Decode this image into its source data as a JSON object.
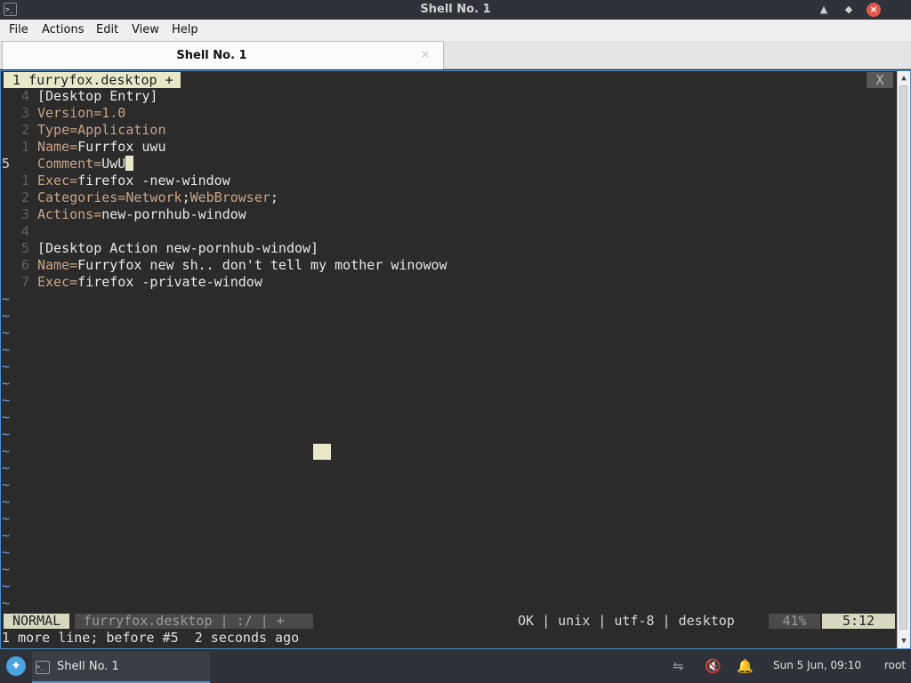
{
  "window": {
    "title": "Shell No. 1",
    "controls": [
      "shade-icon",
      "maximize-icon",
      "close-icon"
    ]
  },
  "menu": [
    {
      "label": "File",
      "x": 0
    },
    {
      "label": "Actions"
    },
    {
      "label": "Edit"
    },
    {
      "label": "View"
    },
    {
      "label": "Help"
    }
  ],
  "tab": {
    "label": "Shell No. 1",
    "close": "×"
  },
  "vim": {
    "buffer_tab": "1 furryfox.desktop +",
    "buffer_close": "X",
    "lines": [
      {
        "num": "4",
        "parts": [
          {
            "t": "[Desktop Entry]",
            "c": "n"
          }
        ]
      },
      {
        "num": "3",
        "parts": [
          {
            "t": "Version=1.0",
            "c": "k"
          }
        ]
      },
      {
        "num": "2",
        "parts": [
          {
            "t": "Type=Application",
            "c": "k"
          }
        ]
      },
      {
        "num": "1",
        "parts": [
          {
            "t": "Name=",
            "c": "k"
          },
          {
            "t": "Furrfox uwu",
            "c": "n"
          }
        ]
      },
      {
        "num": "5",
        "cur": true,
        "parts": [
          {
            "t": "Comment=",
            "c": "k"
          },
          {
            "t": "UwU",
            "c": "n"
          }
        ],
        "cursor": true
      },
      {
        "num": "1",
        "parts": [
          {
            "t": "Exec=",
            "c": "k"
          },
          {
            "t": "firefox -new-window",
            "c": "n"
          }
        ]
      },
      {
        "num": "2",
        "parts": [
          {
            "t": "Categories=Network",
            "c": "k"
          },
          {
            "t": ";",
            "c": "n"
          },
          {
            "t": "WebBrowser",
            "c": "k"
          },
          {
            "t": ";",
            "c": "n"
          }
        ]
      },
      {
        "num": "3",
        "parts": [
          {
            "t": "Actions=",
            "c": "k"
          },
          {
            "t": "new-pornhub-window",
            "c": "n"
          }
        ]
      },
      {
        "num": "4",
        "parts": []
      },
      {
        "num": "5",
        "parts": [
          {
            "t": "[Desktop Action new-pornhub-window]",
            "c": "n"
          }
        ]
      },
      {
        "num": "6",
        "parts": [
          {
            "t": "Name=",
            "c": "k"
          },
          {
            "t": "Furryfox new sh.. don't tell my mother winowow",
            "c": "n"
          }
        ]
      },
      {
        "num": "7",
        "parts": [
          {
            "t": "Exec=",
            "c": "k"
          },
          {
            "t": "firefox -private-window",
            "c": "n"
          }
        ]
      }
    ],
    "tilde_char": "~",
    "status": {
      "mode": "NORMAL",
      "file": "furryfox.desktop | :/ | +",
      "info": "OK | unix | utf-8 | desktop",
      "percent": "41%",
      "position": "5:12"
    },
    "message": "1 more line; before #5  2 seconds ago"
  },
  "taskbar": {
    "start_icon": "manjaro-icon",
    "task_label": "Shell No. 1",
    "tray": [
      "network-off-icon",
      "volume-muted-icon",
      "bell-icon"
    ],
    "clock": "Sun  5 Jun, 09:10",
    "user": "root"
  }
}
